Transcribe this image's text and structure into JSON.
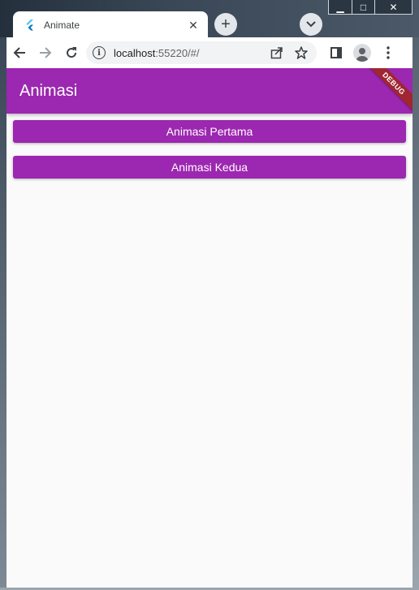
{
  "browser": {
    "tab_title": "Animate",
    "tab_close": "✕",
    "new_tab": "+",
    "url_host": "localhost",
    "url_rest": ":55220/#/",
    "window_controls": {
      "minimize": "▁",
      "maximize": "□",
      "close": "✕"
    }
  },
  "app": {
    "appbar_title": "Animasi",
    "debug_label": "DEBUG",
    "buttons": [
      {
        "label": "Animasi Pertama"
      },
      {
        "label": "Animasi Kedua"
      }
    ],
    "colors": {
      "primary": "#9c27b0",
      "debug_banner": "#a0262f",
      "background": "#fafafa"
    }
  },
  "icons": {
    "back": "back-arrow-icon",
    "forward": "forward-arrow-icon",
    "reload": "reload-icon",
    "info": "site-info-icon",
    "share": "share-icon",
    "bookmark": "star-icon",
    "side_panel": "side-panel-icon",
    "profile": "profile-icon",
    "menu": "kebab-menu-icon",
    "tab_search": "chevron-down-icon",
    "favicon": "flutter-logo-icon"
  }
}
